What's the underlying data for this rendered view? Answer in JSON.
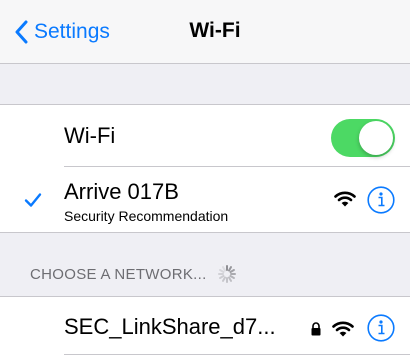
{
  "nav": {
    "back_label": "Settings",
    "title": "Wi-Fi"
  },
  "wifi_row": {
    "label": "Wi-Fi",
    "enabled": true
  },
  "connected_network": {
    "name": "Arrive 017B",
    "subtitle": "Security Recommendation",
    "selected": true
  },
  "section": {
    "header": "CHOOSE A NETWORK..."
  },
  "networks": [
    {
      "name": "SEC_LinkShare_d7...",
      "locked": true
    }
  ],
  "colors": {
    "accent": "#0a7aff",
    "toggle_on": "#4cd964",
    "background": "#efeff4",
    "separator": "#c8c7cc",
    "header_text": "#6d6d72"
  }
}
